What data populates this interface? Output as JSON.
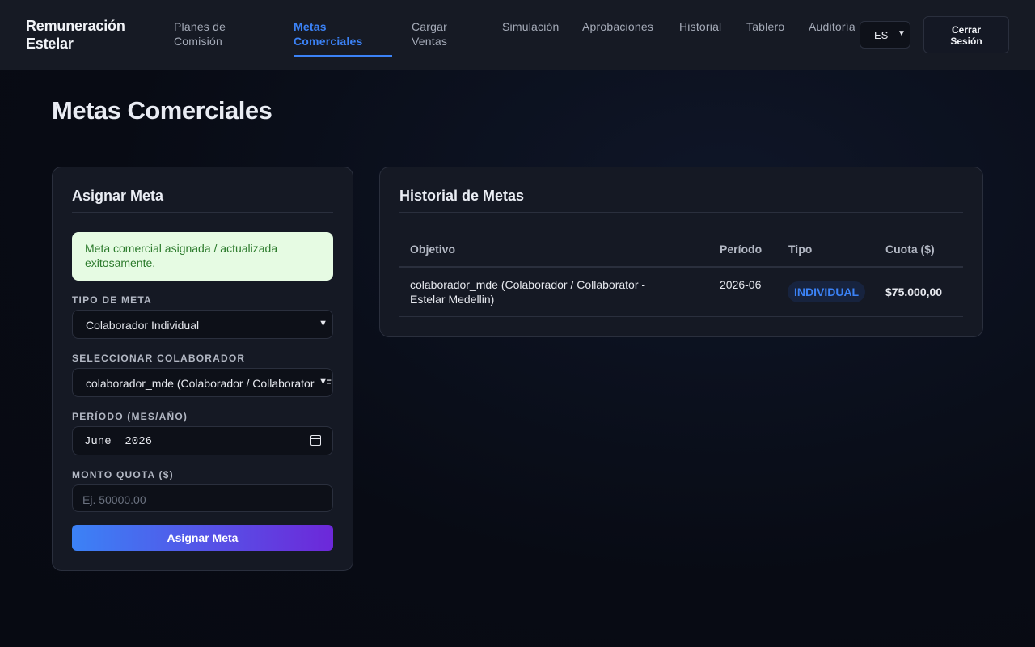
{
  "header": {
    "brand": "Remuneración Estelar",
    "nav": [
      {
        "label": "Planes de Comisión"
      },
      {
        "label": "Metas Comerciales"
      },
      {
        "label": "Cargar Ventas"
      },
      {
        "label": "Simulación"
      },
      {
        "label": "Aprobaciones"
      },
      {
        "label": "Historial"
      },
      {
        "label": "Tablero"
      },
      {
        "label": "Auditoría"
      }
    ],
    "active_nav": "Metas Comerciales",
    "language": "ES",
    "logout_label": "Cerrar Sesión"
  },
  "page_title": "Metas Comerciales",
  "assign_card": {
    "title": "Asignar Meta",
    "success_message": "Meta comercial asignada / actualizada exitosamente.",
    "goal_type_label": "TIPO DE META",
    "goal_type_value": "Colaborador Individual",
    "collaborator_label": "SELECCIONAR COLABORADOR",
    "collaborator_value": "colaborador_mde (Colaborador / Collaborator - Estelar Medellin)",
    "period_label": "PERÍODO (MES/AÑO)",
    "period_value": "June  2026",
    "quota_label": "MONTO QUOTA ($)",
    "quota_placeholder": "Ej. 50000.00",
    "submit_label": "Asignar Meta"
  },
  "history_card": {
    "title": "Historial de Metas",
    "columns": [
      "Objetivo",
      "Período",
      "Tipo",
      "Cuota ($)"
    ],
    "rows": [
      {
        "objective": "colaborador_mde (Colaborador / Collaborator - Estelar Medellin)",
        "period": "2026-06",
        "type": "INDIVIDUAL",
        "quota": "$75.000,00"
      }
    ]
  },
  "colors": {
    "accent": "#3b82f6",
    "gradient_end": "#6d28d9",
    "success_bg": "#e6fbe3",
    "success_text": "#2b7a2b"
  }
}
